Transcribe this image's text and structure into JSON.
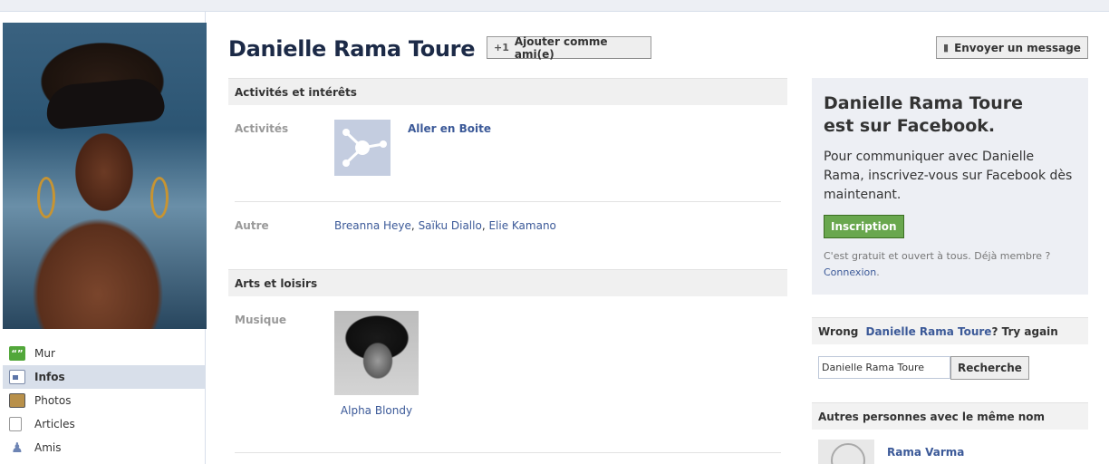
{
  "profile": {
    "name": "Danielle Rama Toure",
    "add_friend_label": "Ajouter comme ami(e)",
    "send_message_label": "Envoyer un message"
  },
  "sidebar": {
    "items": [
      {
        "label": "Mur",
        "icon": "speech-bubble-icon",
        "active": false
      },
      {
        "label": "Infos",
        "icon": "info-card-icon",
        "active": true
      },
      {
        "label": "Photos",
        "icon": "photos-icon",
        "active": false
      },
      {
        "label": "Articles",
        "icon": "note-icon",
        "active": false
      },
      {
        "label": "Amis",
        "icon": "friends-icon",
        "active": false
      }
    ]
  },
  "sections": {
    "activities": {
      "title": "Activités et intérêts",
      "activities_label": "Activités",
      "activity_name": "Aller en Boite",
      "other_label": "Autre",
      "other_links": [
        "Breanna Heye",
        "Saïku Diallo",
        "Elie Kamano"
      ],
      "separator": ", "
    },
    "arts": {
      "title": "Arts et loisirs",
      "music_label": "Musique",
      "music_name": "Alpha Blondy"
    }
  },
  "signup": {
    "title_line1": "Danielle Rama Toure",
    "title_line2": "est sur Facebook.",
    "text": "Pour communiquer avec Danielle Rama, inscrivez-vous sur Facebook dès maintenant.",
    "button_label": "Inscription",
    "note": "C'est gratuit et ouvert à tous. Déjà membre ?",
    "login_link": "Connexion",
    "login_suffix": "."
  },
  "wrong_person": {
    "prefix": "Wrong ",
    "name": "Danielle Rama Toure",
    "suffix": "? Try again",
    "search_value": "Danielle Rama Toure",
    "search_button": "Recherche"
  },
  "same_name": {
    "title": "Autres personnes avec le même nom",
    "people": [
      {
        "name": "Rama Varma"
      }
    ]
  },
  "colors": {
    "link": "#3b5998",
    "header_name": "#1c2a47",
    "signup_button": "#69a74e",
    "panel_bg": "#edeff4"
  }
}
